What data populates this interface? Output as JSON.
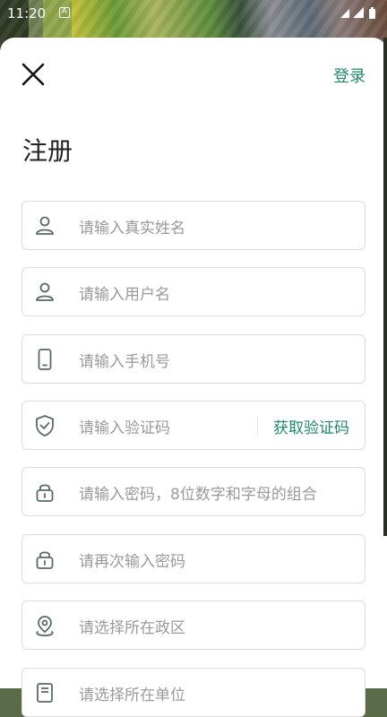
{
  "status": {
    "time": "11:20",
    "indicator": "A"
  },
  "header": {
    "close_icon": "close-icon",
    "login_label": "登录"
  },
  "page": {
    "title": "注册"
  },
  "form": {
    "real_name_placeholder": "请输入真实姓名",
    "username_placeholder": "请输入用户名",
    "phone_placeholder": "请输入手机号",
    "code_placeholder": "请输入验证码",
    "get_code_label": "获取验证码",
    "password_placeholder": "请输入密码，8位数字和字母的组合",
    "confirm_password_placeholder": "请再次输入密码",
    "district_placeholder": "请选择所在政区",
    "unit_placeholder": "请选择所在单位"
  },
  "colors": {
    "accent": "#1f8a64",
    "placeholder": "#9a9a9a",
    "border": "#dcdcdc",
    "icon": "#5a6b61"
  }
}
